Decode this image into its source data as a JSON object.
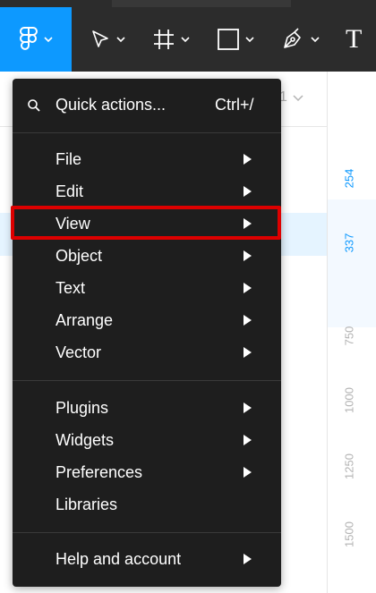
{
  "toolbar": {
    "tools": [
      {
        "icon": "main-menu-icon"
      },
      {
        "icon": "move-tool-icon"
      },
      {
        "icon": "frame-tool-icon"
      },
      {
        "icon": "shape-tool-icon"
      },
      {
        "icon": "pen-tool-icon"
      },
      {
        "icon": "text-tool-icon",
        "glyph": "T"
      }
    ]
  },
  "canvas": {
    "ghost_text": "1",
    "ruler": [
      "254",
      "337",
      "750",
      "1000",
      "1250",
      "1500"
    ]
  },
  "menu": {
    "quick_actions": {
      "label": "Quick actions...",
      "shortcut": "Ctrl+/"
    },
    "group1": [
      "File",
      "Edit",
      "View",
      "Object",
      "Text",
      "Arrange",
      "Vector"
    ],
    "group2": [
      "Plugins",
      "Widgets",
      "Preferences",
      "Libraries"
    ],
    "group3": [
      "Help and account"
    ],
    "highlighted": "View"
  },
  "colors": {
    "accent": "#0d99ff",
    "menu_bg": "#1e1e1e",
    "highlight": "#dd0000"
  }
}
